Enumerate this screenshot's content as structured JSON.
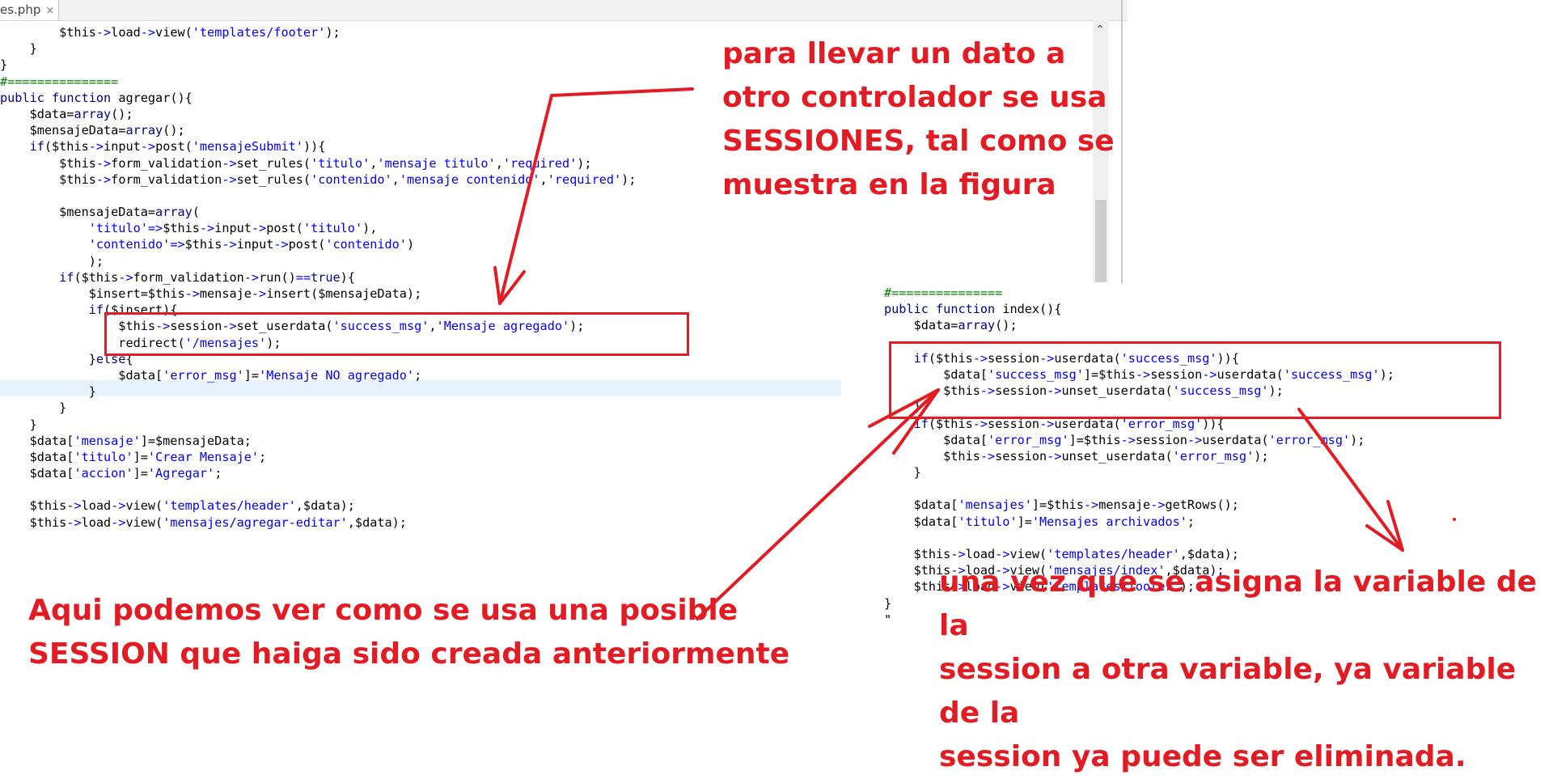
{
  "editor": {
    "tab_label": "es.php",
    "tab_close": "×",
    "scroll_up": "⌃"
  },
  "code_left": [
    "        $this->load->view('templates/footer');",
    "    }",
    "}",
    "#===============",
    "public function agregar(){",
    "    $data=array();",
    "    $mensajeData=array();",
    "    if($this->input->post('mensajeSubmit')){",
    "        $this->form_validation->set_rules('titulo','mensaje titulo','required');",
    "        $this->form_validation->set_rules('contenido','mensaje contenido','required');",
    "",
    "        $mensajeData=array(",
    "            'titulo'=>$this->input->post('titulo'),",
    "            'contenido'=>$this->input->post('contenido')",
    "            );",
    "        if($this->form_validation->run()==true){",
    "            $insert=$this->mensaje->insert($mensajeData);",
    "            if($insert){",
    "                $this->session->set_userdata('success_msg','Mensaje agregado');",
    "                redirect('/mensajes');",
    "            }else{",
    "                $data['error_msg']='Mensaje NO agregado';",
    "            }",
    "        }",
    "    }",
    "    $data['mensaje']=$mensajeData;",
    "    $data['titulo']='Crear Mensaje';",
    "    $data['accion']='Agregar';",
    "",
    "    $this->load->view('templates/header',$data);",
    "    $this->load->view('mensajes/agregar-editar',$data);"
  ],
  "code_right": [
    "#===============",
    "public function index(){",
    "    $data=array();",
    "",
    "    if($this->session->userdata('success_msg')){",
    "        $data['success_msg']=$this->session->userdata('success_msg');",
    "        $this->session->unset_userdata('success_msg');",
    "    }",
    "    if($this->session->userdata('error_msg')){",
    "        $data['error_msg']=$this->session->userdata('error_msg');",
    "        $this->session->unset_userdata('error_msg');",
    "    }",
    "",
    "    $data['mensajes']=$this->mensaje->getRows();",
    "    $data['titulo']='Mensajes archivados';",
    "",
    "    $this->load->view('templates/header',$data);",
    "    $this->load->view('mensajes/index',$data);",
    "    $this->load->view('templates/footer');",
    "}",
    "\""
  ],
  "annotations": {
    "top_right": [
      "para llevar un dato a",
      "otro controlador se usa",
      "SESSIONES, tal como se",
      "muestra en la figura"
    ],
    "bottom_left": [
      "Aqui podemos ver como se usa una posible",
      "SESSION que haiga sido creada anteriormente"
    ],
    "bottom_right": [
      "una vez que se asigna la variable de la",
      "session a otra variable, ya variable de la",
      "session ya puede ser eliminada."
    ]
  },
  "colors": {
    "annotation_red": "#e31b23",
    "keyword": "#00008b",
    "string": "#0000ff",
    "comment": "#008000"
  }
}
